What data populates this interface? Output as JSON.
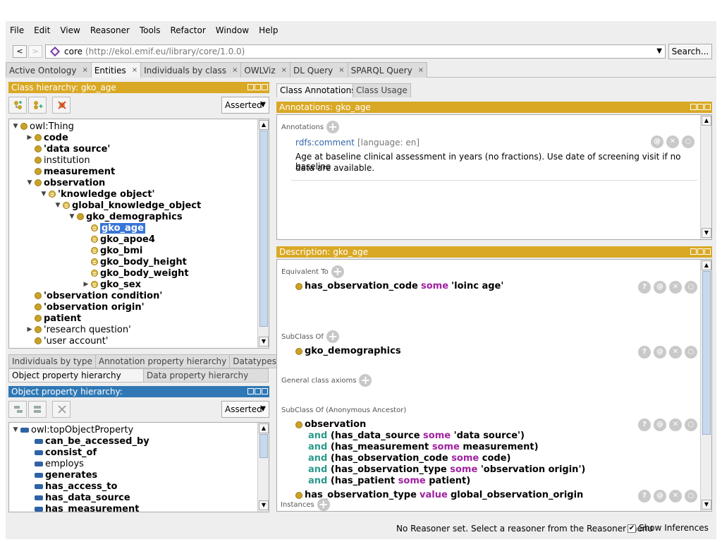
{
  "menu": [
    "File",
    "Edit",
    "View",
    "Reasoner",
    "Tools",
    "Refactor",
    "Window",
    "Help"
  ],
  "address": {
    "back": "<",
    "forward": ">",
    "ontology_name": "core",
    "ontology_iri": "(http://ekol.emif.eu/library/core/1.0.0)",
    "search_label": "Search..."
  },
  "tabs": [
    {
      "label": "Active Ontology"
    },
    {
      "label": "Entities"
    },
    {
      "label": "Individuals by class"
    },
    {
      "label": "OWLViz"
    },
    {
      "label": "DL Query"
    },
    {
      "label": "SPARQL Query"
    }
  ],
  "class_hierarchy": {
    "title": "Class hierarchy: gko_age",
    "mode": "Asserted",
    "items": [
      {
        "label": "owl:Thing",
        "depth": 0,
        "exp": "open",
        "bold": false,
        "icon": "dot"
      },
      {
        "label": "code",
        "depth": 1,
        "exp": "closed",
        "bold": true,
        "icon": "dot"
      },
      {
        "label": "'data source'",
        "depth": 1,
        "exp": "",
        "bold": true,
        "icon": "dot"
      },
      {
        "label": "institution",
        "depth": 1,
        "exp": "",
        "bold": false,
        "icon": "dot"
      },
      {
        "label": "measurement",
        "depth": 1,
        "exp": "",
        "bold": true,
        "icon": "dot"
      },
      {
        "label": "observation",
        "depth": 1,
        "exp": "open",
        "bold": true,
        "icon": "dot"
      },
      {
        "label": "'knowledge object'",
        "depth": 2,
        "exp": "open",
        "bold": true,
        "icon": "eq"
      },
      {
        "label": "global_knowledge_object",
        "depth": 3,
        "exp": "open",
        "bold": true,
        "icon": "eq"
      },
      {
        "label": "gko_demographics",
        "depth": 4,
        "exp": "open",
        "bold": true,
        "icon": "dot"
      },
      {
        "label": "gko_age",
        "depth": 5,
        "exp": "",
        "bold": true,
        "icon": "eq",
        "selected": true
      },
      {
        "label": "gko_apoe4",
        "depth": 5,
        "exp": "",
        "bold": true,
        "icon": "eq"
      },
      {
        "label": "gko_bmi",
        "depth": 5,
        "exp": "",
        "bold": true,
        "icon": "eq"
      },
      {
        "label": "gko_body_height",
        "depth": 5,
        "exp": "",
        "bold": true,
        "icon": "eq"
      },
      {
        "label": "gko_body_weight",
        "depth": 5,
        "exp": "",
        "bold": true,
        "icon": "eq"
      },
      {
        "label": "gko_sex",
        "depth": 5,
        "exp": "closed",
        "bold": true,
        "icon": "eq"
      },
      {
        "label": "'observation condition'",
        "depth": 1,
        "exp": "",
        "bold": true,
        "icon": "dot"
      },
      {
        "label": "'observation origin'",
        "depth": 1,
        "exp": "",
        "bold": true,
        "icon": "dot"
      },
      {
        "label": "patient",
        "depth": 1,
        "exp": "",
        "bold": true,
        "icon": "dot"
      },
      {
        "label": "'research question'",
        "depth": 1,
        "exp": "closed",
        "bold": false,
        "icon": "dot"
      },
      {
        "label": "'user account'",
        "depth": 1,
        "exp": "",
        "bold": false,
        "icon": "dot"
      }
    ]
  },
  "left_subtabs_row1": [
    "Individuals by type",
    "Annotation property hierarchy",
    "Datatypes"
  ],
  "left_subtabs_row2": [
    "Object property hierarchy",
    "Data property hierarchy"
  ],
  "object_property_hierarchy": {
    "title": "Object property hierarchy:",
    "mode": "Asserted",
    "items": [
      {
        "label": "owl:topObjectProperty",
        "depth": 0,
        "exp": "open",
        "bold": false
      },
      {
        "label": "can_be_accessed_by",
        "depth": 1,
        "exp": "",
        "bold": true
      },
      {
        "label": "consist_of",
        "depth": 1,
        "exp": "",
        "bold": true
      },
      {
        "label": "employs",
        "depth": 1,
        "exp": "",
        "bold": false
      },
      {
        "label": "generates",
        "depth": 1,
        "exp": "",
        "bold": true
      },
      {
        "label": "has_access_to",
        "depth": 1,
        "exp": "",
        "bold": true
      },
      {
        "label": "has_data_source",
        "depth": 1,
        "exp": "",
        "bold": true
      },
      {
        "label": "has_measurement",
        "depth": 1,
        "exp": "",
        "bold": true
      }
    ]
  },
  "right_tabs": [
    "Class Annotations",
    "Class Usage"
  ],
  "annotations": {
    "title": "Annotations: gko_age",
    "section": "Annotations",
    "property": "rdfs:comment",
    "language": "[language: en]",
    "text_line1": "Age at baseline clinical assessment in years (no fractions). Use date of screening visit if no baseline",
    "text_line2": "data are available."
  },
  "description": {
    "title": "Description: gko_age",
    "equivalent_to": "Equivalent To",
    "eq_axiom": {
      "prop": "has_observation_code",
      "kw": "some",
      "filler": "'loinc age'"
    },
    "subclass_of": "SubClass Of",
    "sub_axiom": "gko_demographics",
    "general_axioms": "General class axioms",
    "anon_ancestor": "SubClass Of (Anonymous Ancestor)",
    "anon_head": "observation",
    "anon_lines": [
      {
        "and": "and",
        "open": "(has_data_source",
        "kw": "some",
        "rest": "'data source')"
      },
      {
        "and": "and",
        "open": "(has_measurement",
        "kw": "some",
        "rest": "measurement)"
      },
      {
        "and": "and",
        "open": "(has_observation_code",
        "kw": "some",
        "rest": "code)"
      },
      {
        "and": "and",
        "open": "(has_observation_type",
        "kw": "some",
        "rest": "'observation origin')"
      },
      {
        "and": "and",
        "open": "(has_patient",
        "kw": "some",
        "rest": "patient)"
      }
    ],
    "value_axiom": {
      "prop": "has_observation_type",
      "kw": "value",
      "filler": "global_observation_origin"
    },
    "instances": "Instances"
  },
  "status": {
    "reasoner": "No Reasoner set. Select a reasoner from the Reasoner menu",
    "show_inferences": "Show Inferences",
    "show_inferences_checked": true
  },
  "colors": {
    "header_gold": "#d9a824",
    "header_blue": "#2f78b5",
    "keyword_magenta": "#a020a0",
    "keyword_teal": "#2a9a8a",
    "selection": "#3875d7"
  }
}
